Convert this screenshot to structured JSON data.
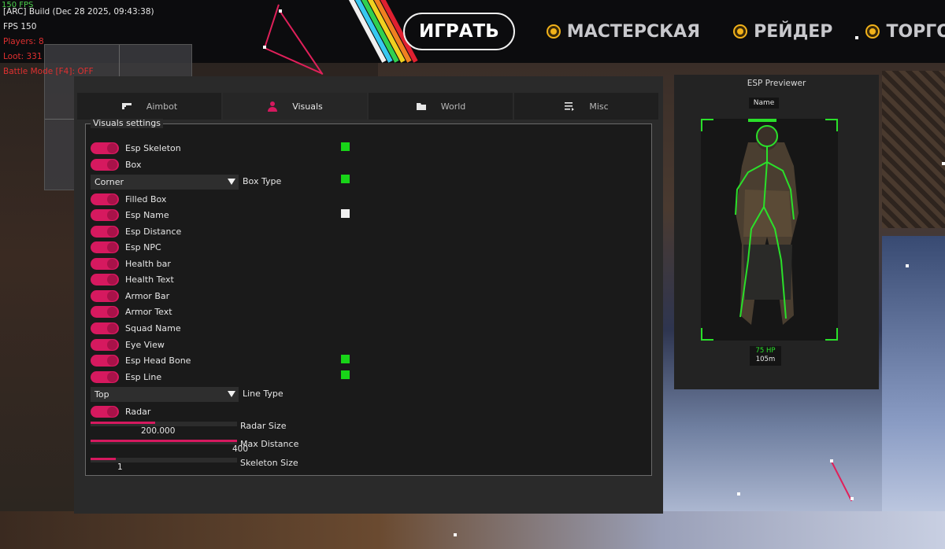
{
  "debug": {
    "fps_top": "150 FPS",
    "build": "[ARC] Build (Dec 28 2025, 09:43:38)",
    "fps": "FPS 150",
    "players": "Players:  8",
    "loot": "Loot:  331",
    "battle_mode": "Battle Mode [F4]: OFF"
  },
  "nav": {
    "play": "ИГРАТЬ",
    "items": [
      "МАСТЕРСКАЯ",
      "РЕЙДЕР",
      "ТОРГОВЦ"
    ]
  },
  "tabs": [
    {
      "label": "Aimbot",
      "icon": "gun-icon",
      "active": false
    },
    {
      "label": "Visuals",
      "icon": "user-icon",
      "active": true
    },
    {
      "label": "World",
      "icon": "folder-icon",
      "active": false
    },
    {
      "label": "Misc",
      "icon": "list-icon",
      "active": false
    }
  ],
  "visuals": {
    "group_title": "Visuals settings",
    "esp_skeleton": "Esp Skeleton",
    "box": "Box",
    "box_type_value": "Corner",
    "box_type_label": "Box Type",
    "filled_box": "Filled Box",
    "esp_name": "Esp Name",
    "esp_distance": "Esp Distance",
    "esp_npc": "Esp NPC",
    "health_bar": "Health bar",
    "health_text": "Health Text",
    "armor_bar": "Armor Bar",
    "armor_text": "Armor Text",
    "squad_name": "Squad Name",
    "eye_view": "Eye View",
    "esp_head_bone": "Esp Head Bone",
    "esp_line": "Esp Line",
    "line_type_value": "Top",
    "line_type_label": "Line Type",
    "radar": "Radar",
    "radar_size_label": "Radar Size",
    "radar_size_value": "200.000",
    "radar_size_fill": 0.44,
    "max_distance_label": "Max Distance",
    "max_distance_value": "400",
    "max_distance_fill": 1.0,
    "skeleton_size_label": "Skeleton Size",
    "skeleton_size_value": "1",
    "skeleton_size_fill": 0.17
  },
  "colors": {
    "accent": "#d6195f",
    "swatch_green": "#18d418",
    "swatch_white": "#f0f0f0",
    "esp_green": "#2ae02a"
  },
  "esp_preview": {
    "title": "ESP Previewer",
    "name": "Name",
    "hp": "75 HP",
    "distance": "105m"
  }
}
